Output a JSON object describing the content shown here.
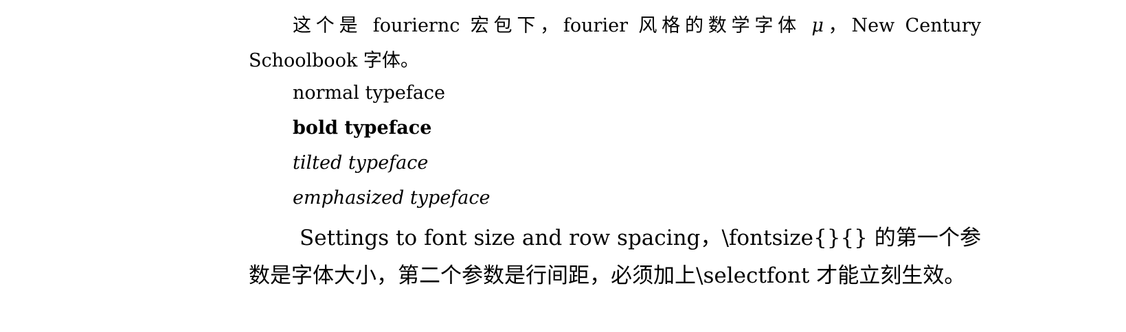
{
  "document": {
    "para1": {
      "part1": "这个是 fouriernc 宏包下，fourier 风格的数学字体 ",
      "math_symbol": "μ",
      "part2": "，New Century Schoolbook 字体。"
    },
    "typefaces": {
      "normal": "normal typeface",
      "bold": "bold typeface",
      "tilted": "tilted typeface",
      "emphasized": "emphasized typeface"
    },
    "para2": {
      "text": "Settings to font size and row spacing，\\fontsize{}{} 的第一个参数是字体大小，第二个参数是行间距，必须加上\\selectfont 才能立刻生效。"
    }
  }
}
